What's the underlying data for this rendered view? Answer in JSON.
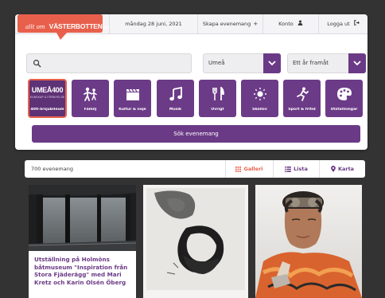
{
  "header": {
    "logo": {
      "allt": "allt om",
      "main": "VÄSTERBOTTEN",
      "tld": ".se"
    },
    "date": "måndag 28 juni, 2021",
    "links": [
      {
        "label": "Skapa evenemang",
        "icon": "plus-icon"
      },
      {
        "label": "Konto",
        "icon": "person-icon"
      },
      {
        "label": "Logga ut",
        "icon": "logout-icon"
      }
    ]
  },
  "search": {
    "value": "",
    "placeholder": "",
    "location": "Umeå",
    "period": "Ett år framåt"
  },
  "categories": [
    {
      "label": "400-årsjubileum",
      "icon": "umea-400-badge",
      "badge": "UMEÅ400",
      "badge_sub": "KUNSKAP & FÖRNYELSE",
      "active": true
    },
    {
      "label": "Familj",
      "icon": "family-icon"
    },
    {
      "label": "Kultur & nöje",
      "icon": "clapperboard-icon"
    },
    {
      "label": "Musik",
      "icon": "music-note-icon"
    },
    {
      "label": "Övrigt",
      "icon": "cutlery-icon"
    },
    {
      "label": "Skollov",
      "icon": "sun-icon"
    },
    {
      "label": "Sport & fritid",
      "icon": "running-icon"
    },
    {
      "label": "Utställningar",
      "icon": "palette-icon"
    }
  ],
  "search_button": "Sök evenemang",
  "results": {
    "count_label": "700 evenemang",
    "views": [
      {
        "label": "Galleri",
        "icon": "grid-icon",
        "active": true
      },
      {
        "label": "Lista",
        "icon": "list-icon",
        "active": false
      },
      {
        "label": "Karta",
        "icon": "map-pin-icon",
        "active": false
      }
    ]
  },
  "events": [
    {
      "title": "Utställning på Holmöns båtmuseum \"Inspiration från Stora Fjäderägg\" med Mari Kretz och Karin Olsén Öberg"
    },
    {
      "title": ""
    },
    {
      "title": ""
    }
  ],
  "colors": {
    "brand_purple": "#6b3a86",
    "accent_coral": "#e8604c",
    "page_background": "#333333"
  }
}
